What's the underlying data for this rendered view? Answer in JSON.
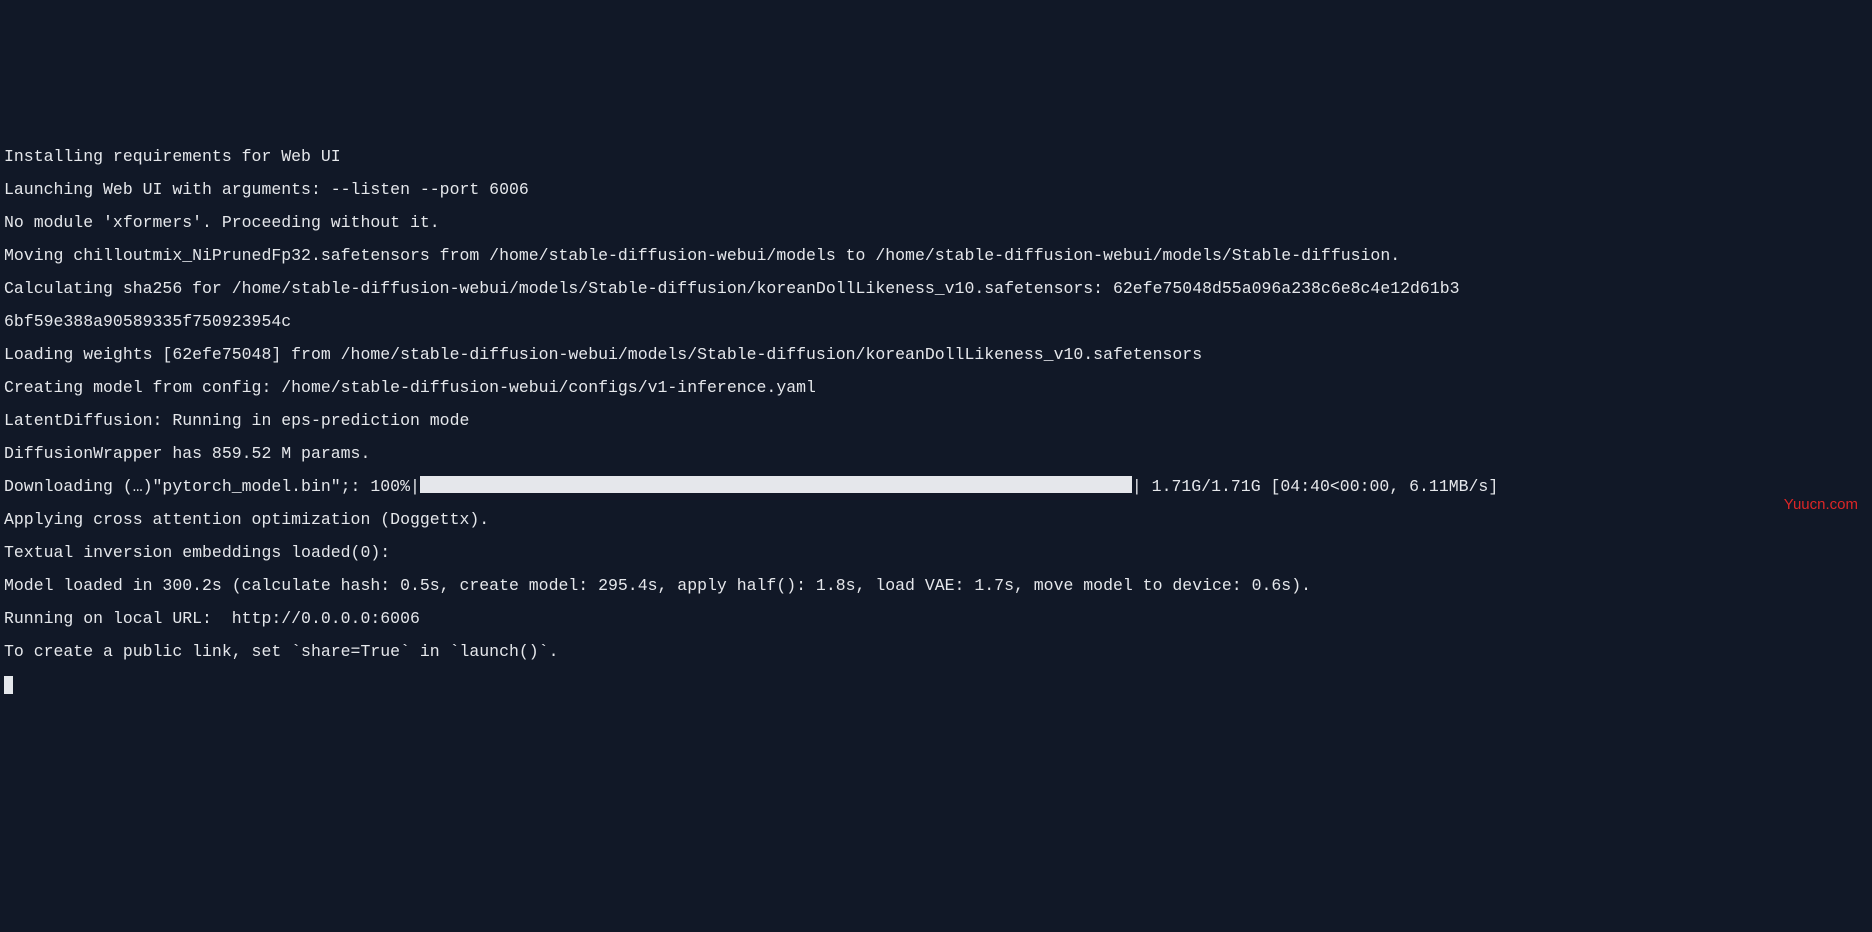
{
  "lines": {
    "l1": "Installing requirements for Web UI",
    "l2": "Launching Web UI with arguments: --listen --port 6006",
    "l3": "No module 'xformers'. Proceeding without it.",
    "l4": "Moving chilloutmix_NiPrunedFp32.safetensors from /home/stable-diffusion-webui/models to /home/stable-diffusion-webui/models/Stable-diffusion.",
    "l5": "Calculating sha256 for /home/stable-diffusion-webui/models/Stable-diffusion/koreanDollLikeness_v10.safetensors: 62efe75048d55a096a238c6e8c4e12d61b3",
    "l6": "6bf59e388a90589335f750923954c",
    "l7": "Loading weights [62efe75048] from /home/stable-diffusion-webui/models/Stable-diffusion/koreanDollLikeness_v10.safetensors",
    "l8": "Creating model from config: /home/stable-diffusion-webui/configs/v1-inference.yaml",
    "l9": "LatentDiffusion: Running in eps-prediction mode",
    "l10": "DiffusionWrapper has 859.52 M params.",
    "download_prefix": "Downloading (…)\"pytorch_model.bin\";: 100%|",
    "download_suffix": "| 1.71G/1.71G [04:40<00:00, 6.11MB/s]",
    "l12": "Applying cross attention optimization (Doggettx).",
    "l13": "Textual inversion embeddings loaded(0):",
    "l14": "Model loaded in 300.2s (calculate hash: 0.5s, create model: 295.4s, apply half(): 1.8s, load VAE: 1.7s, move model to device: 0.6s).",
    "l15": "Running on local URL:  http://0.0.0.0:6006",
    "l16": "",
    "l17": "To create a public link, set `share=True` in `launch()`."
  },
  "watermark": "Yuucn.com"
}
